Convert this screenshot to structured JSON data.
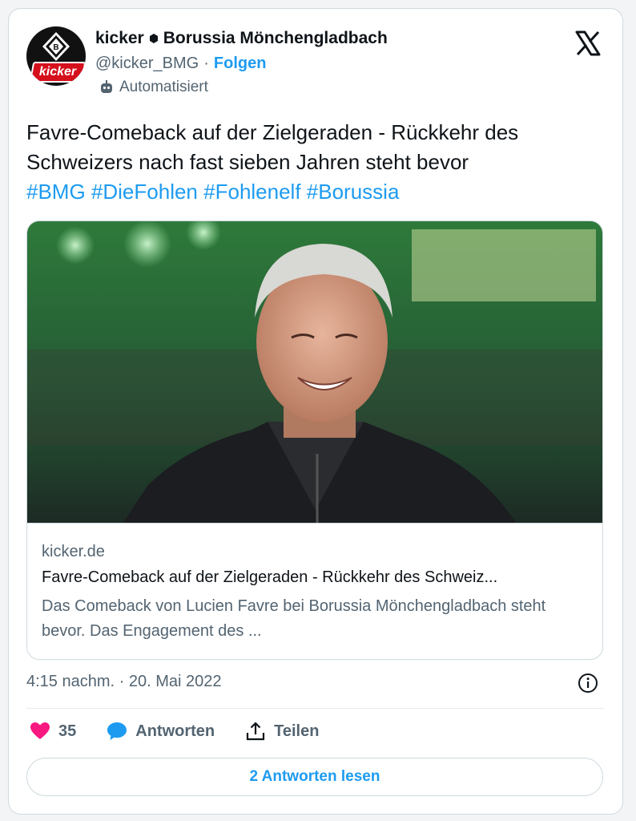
{
  "header": {
    "account_name": "kicker",
    "account_secondary": "Borussia Mönchengladbach",
    "handle": "@kicker_BMG",
    "separator": "·",
    "follow_label": "Folgen",
    "automated_label": "Automatisiert",
    "avatar_text": "kicker",
    "platform_icon": "x-logo-icon"
  },
  "tweet": {
    "text": "Favre-Comeback auf der Zielgeraden - Rückkehr des Schweizers nach fast sieben Jahren steht bevor",
    "hashtags": [
      "#BMG",
      "#DieFohlen",
      "#Fohlenelf",
      "#Borussia"
    ]
  },
  "link_card": {
    "domain": "kicker.de",
    "title": "Favre-Comeback auf der Zielgeraden - Rückkehr des Schweiz...",
    "description": "Das Comeback von Lucien Favre bei Borussia Mönchengladbach steht bevor. Das Engagement des ..."
  },
  "meta": {
    "timestamp": "4:15 nachm. · 20. Mai 2022"
  },
  "actions": {
    "like_count": "35",
    "reply_label": "Antworten",
    "share_label": "Teilen"
  },
  "read_replies_label": "2 Antworten lesen",
  "colors": {
    "accent": "#1d9bf0",
    "like": "#f91880",
    "text": "#0f1419",
    "muted": "#536471",
    "kicker_red": "#d50f1c"
  }
}
